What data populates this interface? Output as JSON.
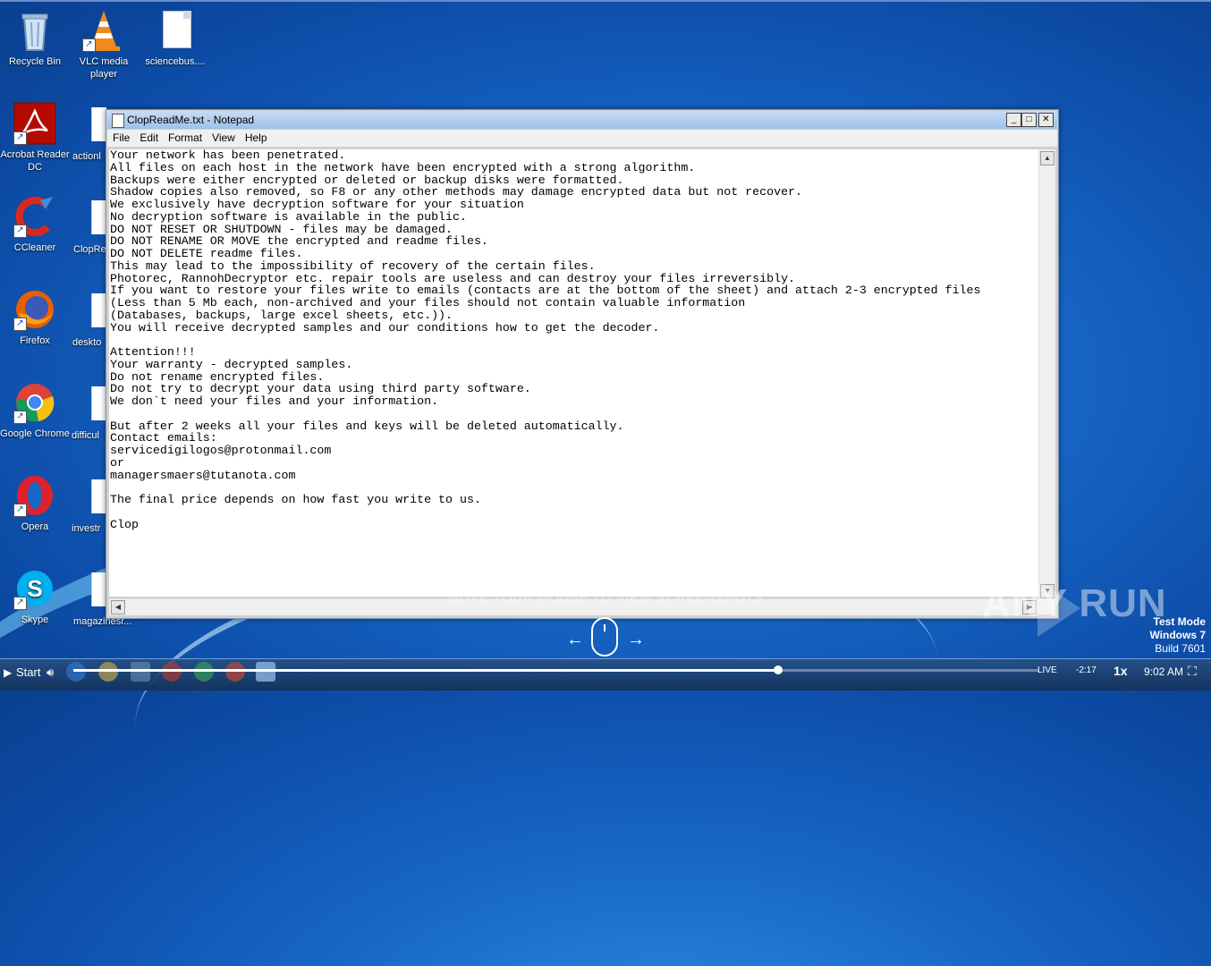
{
  "desktop": {
    "icons": [
      {
        "label": "Recycle Bin",
        "kind": "recycle-bin"
      },
      {
        "label": "VLC media player",
        "kind": "vlc"
      },
      {
        "label": "sciencebus....",
        "kind": "file"
      },
      {
        "label": "Acrobat Reader DC",
        "kind": "acrobat"
      },
      {
        "label": "CCleaner",
        "kind": "ccleaner"
      },
      {
        "label": "Firefox",
        "kind": "firefox"
      },
      {
        "label": "Google Chrome",
        "kind": "chrome"
      },
      {
        "label": "Opera",
        "kind": "opera"
      },
      {
        "label": "Skype",
        "kind": "skype"
      }
    ],
    "partial_labels": [
      "actionl",
      "ClopRe",
      "deskto",
      "difficul",
      "investr",
      "magazinesr..."
    ]
  },
  "notepad": {
    "title": "ClopReadMe.txt - Notepad",
    "menu": [
      "File",
      "Edit",
      "Format",
      "View",
      "Help"
    ],
    "content": "Your network has been penetrated.\nAll files on each host in the network have been encrypted with a strong algorithm.\nBackups were either encrypted or deleted or backup disks were formatted.\nShadow copies also removed, so F8 or any other methods may damage encrypted data but not recover.\nWe exclusively have decryption software for your situation\nNo decryption software is available in the public.\nDO NOT RESET OR SHUTDOWN - files may be damaged.\nDO NOT RENAME OR MOVE the encrypted and readme files.\nDO NOT DELETE readme files.\nThis may lead to the impossibility of recovery of the certain files.\nPhotorec, RannohDecryptor etc. repair tools are useless and can destroy your files irreversibly.\nIf you want to restore your files write to emails (contacts are at the bottom of the sheet) and attach 2-3 encrypted files\n(Less than 5 Mb each, non-archived and your files should not contain valuable information\n(Databases, backups, large excel sheets, etc.)).\nYou will receive decrypted samples and our conditions how to get the decoder.\n\nAttention!!!\nYour warranty - decrypted samples.\nDo not rename encrypted files.\nDo not try to decrypt your data using third party software.\nWe don`t need your files and your information.\n\nBut after 2 weeks all your files and keys will be deleted automatically.\nContact emails:\nservicedigilogos@protonmail.com\nor\nmanagersmaers@tutanota.com\n\nThe final price depends on how fast you write to us.\n\nClop"
  },
  "player": {
    "hint": "MOVE YOUR MOUSE TO VIEW SCREENSHOTS",
    "watermark": "ANY RUN",
    "live_label": "LIVE",
    "time_remaining": "-2:17",
    "speed": "1x",
    "progress_fraction": 0.73
  },
  "os": {
    "test_mode": "Test Mode",
    "windows": "Windows 7",
    "build": "Build 7601",
    "start_label": "Start",
    "clock": "9:02 AM"
  },
  "colors": {
    "desktop_blue": "#1767c7",
    "title_bar": "#9fc0ea",
    "taskbar": "#1d3f6e"
  }
}
